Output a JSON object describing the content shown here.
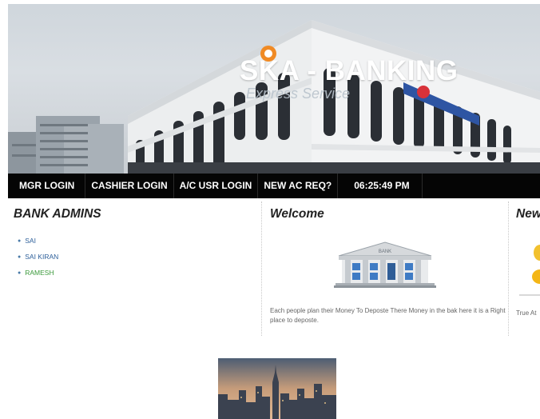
{
  "banner": {
    "title": "SKA - BANKING",
    "subtitle": "Express Service",
    "logo_icon": "bank-logo-icon"
  },
  "nav": {
    "items": [
      {
        "label": "MGR LOGIN"
      },
      {
        "label": "CASHIER LOGIN"
      },
      {
        "label": "A/C USR LOGIN"
      },
      {
        "label": "NEW AC REQ?"
      }
    ],
    "clock": "06:25:49 PM"
  },
  "admins": {
    "heading": "BANK ADMINS",
    "items": [
      {
        "name": "SAI",
        "color": "#2d5f9a"
      },
      {
        "name": "SAI KIRAN",
        "color": "#2d5f9a"
      },
      {
        "name": "RAMESH",
        "color": "#3c9a3c"
      }
    ]
  },
  "welcome": {
    "heading": "Welcome",
    "icon": "bank-building-icon",
    "text": "Each people plan their Money To Deposte There Money in the bak here it is a Right place to deposte."
  },
  "news": {
    "heading": "News",
    "icon": "coin-icon",
    "text": "True At"
  },
  "colors": {
    "nav_bg": "#050505",
    "link_blue": "#2d5f9a",
    "link_green": "#3c9a3c"
  }
}
